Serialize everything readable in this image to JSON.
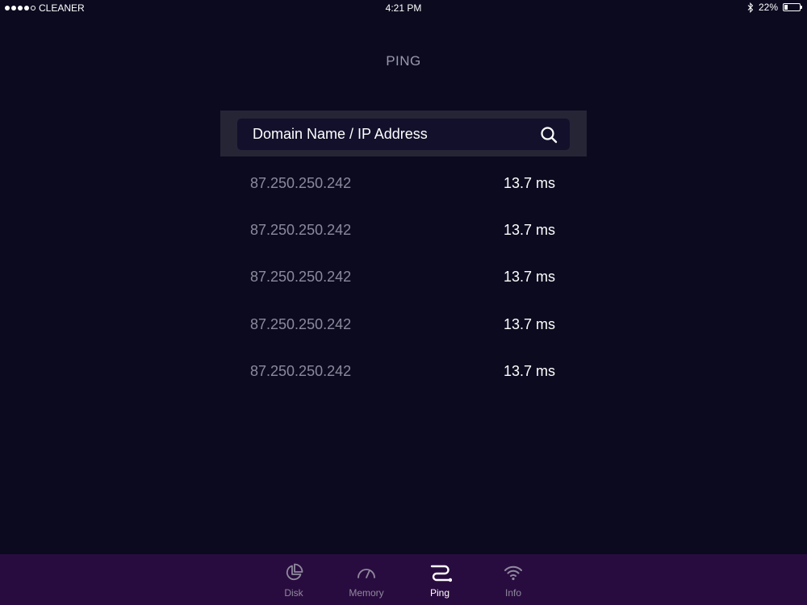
{
  "status_bar": {
    "carrier": "CLEANER",
    "time": "4:21 PM",
    "battery_percent": "22%",
    "battery_level": 0.22
  },
  "page": {
    "title": "PING"
  },
  "search": {
    "placeholder": "Domain Name / IP Address"
  },
  "results": [
    {
      "ip": "87.250.250.242",
      "time": "13.7 ms"
    },
    {
      "ip": "87.250.250.242",
      "time": "13.7 ms"
    },
    {
      "ip": "87.250.250.242",
      "time": "13.7 ms"
    },
    {
      "ip": "87.250.250.242",
      "time": "13.7 ms"
    },
    {
      "ip": "87.250.250.242",
      "time": "13.7 ms"
    }
  ],
  "tabs": [
    {
      "label": "Disk",
      "icon": "pie-chart-icon",
      "active": false
    },
    {
      "label": "Memory",
      "icon": "gauge-icon",
      "active": false
    },
    {
      "label": "Ping",
      "icon": "route-icon",
      "active": true
    },
    {
      "label": "Info",
      "icon": "wifi-icon",
      "active": false
    }
  ],
  "colors": {
    "background": "#0b0a1f",
    "tab_bar": "#290c3f",
    "search_panel": "#262536",
    "search_field": "#12102b",
    "muted_text": "#8b8a9c"
  }
}
